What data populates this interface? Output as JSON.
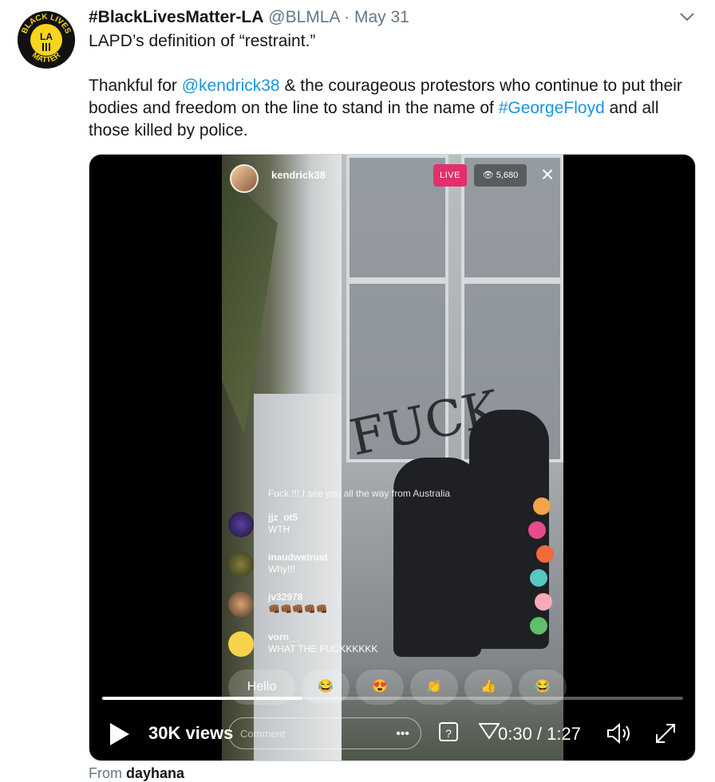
{
  "tweet": {
    "display_name": "#BlackLivesMatter-LA",
    "handle": "@BLMLA",
    "separator": "·",
    "date": "May 31",
    "line1": "LAPD’s definition of “restraint.”",
    "line2_pre": "Thankful for ",
    "mention": "@kendrick38",
    "line2_post": " & the courageous protestors who continue to put their bodies and freedom on the line to stand in the name of ",
    "hashtag": "#GeorgeFloyd",
    "line2_end": " and all those killed by police.",
    "avatar_text_top": "BLACK LIVES",
    "avatar_text_mid": "LA",
    "avatar_text_bottom": "MATTER"
  },
  "video": {
    "ig_username": "kendrick38",
    "live_label": "LIVE",
    "viewer_count": "5,680",
    "graffiti": "FUCK",
    "comments": [
      {
        "user": "",
        "text": "Fuck !!! I see you all the way from Australia"
      },
      {
        "user": "jjz_ot5",
        "text": "WTH"
      },
      {
        "user": "inaudwetrust",
        "text": "Why!!!"
      },
      {
        "user": "jv32978",
        "text": "👊🏾👊🏾👊🏾👊🏾👊🏾"
      },
      {
        "user": "vorn__",
        "text": "WHAT THE FUCKKKKKK"
      }
    ],
    "reactions": [
      "Hello",
      "😂",
      "😍",
      "👏",
      "👍",
      "😂"
    ],
    "comment_placeholder": "Comment",
    "comment_dots": "•••",
    "question_icon": "?",
    "views": "30K views",
    "time": "0:30 / 1:27",
    "progress": 0.345
  },
  "from_label": "From",
  "from_user": "dayhana"
}
